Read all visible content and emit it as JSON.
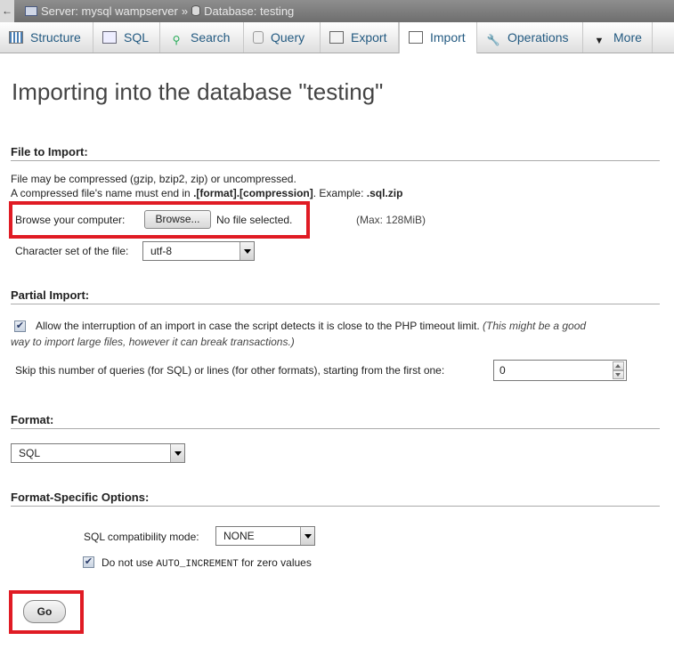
{
  "breadcrumb": {
    "back_icon": "←",
    "server": "Server: mysql wampserver",
    "separator": "»",
    "database": "Database: testing"
  },
  "tabs": [
    {
      "label": "Structure",
      "icon": "structure-icon"
    },
    {
      "label": "SQL",
      "icon": "sql-icon"
    },
    {
      "label": "Search",
      "icon": "search-icon"
    },
    {
      "label": "Query",
      "icon": "query-icon"
    },
    {
      "label": "Export",
      "icon": "export-icon"
    },
    {
      "label": "Import",
      "icon": "import-icon",
      "active": true
    },
    {
      "label": "Operations",
      "icon": "wrench-icon"
    },
    {
      "label": "More",
      "icon": "chevron-down-icon"
    }
  ],
  "page_title": "Importing into the database \"testing\"",
  "file_to_import": {
    "legend": "File to Import:",
    "line1": "File may be compressed (gzip, bzip2, zip) or uncompressed.",
    "line2_prefix": "A compressed file's name must end in ",
    "line2_bold": ".[format].[compression]",
    "line2_mid": ". Example: ",
    "line2_example": ".sql.zip",
    "browse_label": "Browse your computer:",
    "browse_button": "Browse...",
    "no_file": "No file selected.",
    "max_size": "(Max: 128MiB)",
    "charset_label": "Character set of the file:",
    "charset_value": "utf-8"
  },
  "partial_import": {
    "legend": "Partial Import:",
    "allow_interrupt_checked": true,
    "allow_interrupt_label": "Allow the interruption of an import in case the script detects it is close to the PHP timeout limit.",
    "allow_interrupt_hint_1": "(This might be a good",
    "allow_interrupt_hint_2": "way to import large files, however it can break transactions.)",
    "skip_label": "Skip this number of queries (for SQL) or lines (for other formats), starting from the first one:",
    "skip_value": "0"
  },
  "format": {
    "legend": "Format:",
    "value": "SQL"
  },
  "format_options": {
    "legend": "Format-Specific Options:",
    "compat_label": "SQL compatibility mode:",
    "compat_value": "NONE",
    "auto_inc_checked": true,
    "auto_inc_prefix": "Do not use ",
    "auto_inc_code": "AUTO_INCREMENT",
    "auto_inc_suffix": " for zero values"
  },
  "go_button": "Go",
  "colors": {
    "highlight": "#e01b24",
    "tab_text": "#235a81",
    "breadcrumb_bg": "#7a7a7a"
  }
}
